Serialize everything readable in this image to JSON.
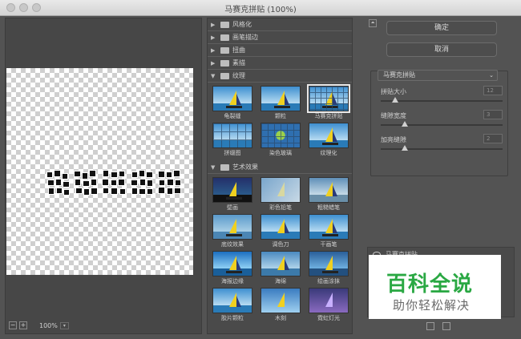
{
  "window": {
    "title": "马赛克拼贴 (100%)"
  },
  "preview": {
    "zoom_level": "100%",
    "zoom_out": "−",
    "zoom_in": "+",
    "zoom_dropdown": "▾"
  },
  "gallery": {
    "categories": [
      {
        "label": "风格化",
        "expanded": false
      },
      {
        "label": "画笔描边",
        "expanded": false
      },
      {
        "label": "扭曲",
        "expanded": false
      },
      {
        "label": "素描",
        "expanded": false
      },
      {
        "label": "纹理",
        "expanded": true
      },
      {
        "label": "艺术效果",
        "expanded": true
      }
    ],
    "texture_items": [
      "龟裂缝",
      "颗粒",
      "马赛克拼贴",
      "拼缀图",
      "染色玻璃",
      "纹理化"
    ],
    "artistic_items": [
      "壁画",
      "彩色铅笔",
      "粗糙蜡笔",
      "底纹效果",
      "调色刀",
      "干画笔",
      "海报边缘",
      "海绵",
      "绘画涂抹",
      "胶片颗粒",
      "木刻",
      "霓虹灯光"
    ],
    "selected": "马赛克拼贴"
  },
  "controls": {
    "ok_label": "确定",
    "cancel_label": "取消",
    "filter_name": "马赛克拼贴",
    "params": [
      {
        "label": "拼贴大小",
        "value": "12",
        "fraction": 0.12
      },
      {
        "label": "缝隙宽度",
        "value": "3",
        "fraction": 0.2
      },
      {
        "label": "加亮缝隙",
        "value": "2",
        "fraction": 0.2
      }
    ],
    "layer_label": "马赛克拼贴"
  },
  "watermark": {
    "title": "百科全说",
    "subtitle": "助你轻松解决"
  },
  "colors": {
    "panel": "#535353",
    "watermark_green": "#2aa843"
  }
}
